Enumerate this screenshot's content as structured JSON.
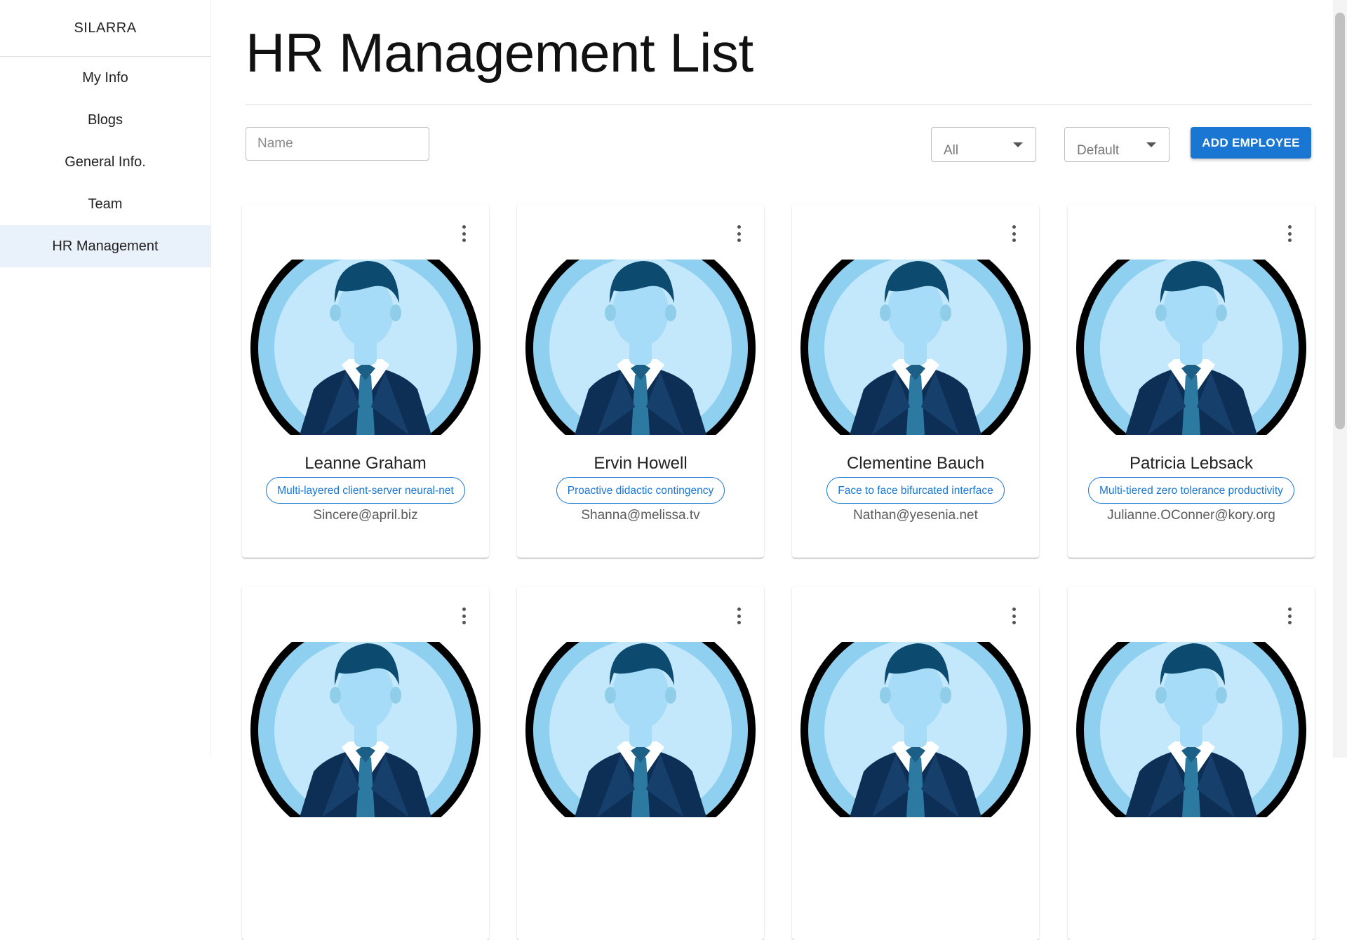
{
  "sidebar": {
    "brand": "SILARRA",
    "items": [
      {
        "label": "My Info"
      },
      {
        "label": "Blogs"
      },
      {
        "label": "General Info."
      },
      {
        "label": "Team"
      },
      {
        "label": "HR Management",
        "active": true
      }
    ]
  },
  "main": {
    "title": "HR Management List",
    "search": {
      "placeholder": "Name",
      "value": ""
    },
    "role_filter": {
      "selected": "All"
    },
    "sort_select": {
      "selected": "Default"
    },
    "add_button": "ADD EMPLOYEE"
  },
  "colors": {
    "accent": "#1976d2",
    "active_nav_bg": "#e9f1fb",
    "avatar_ring": "#000000",
    "avatar_bg": "#8fd0f0"
  },
  "employees": [
    {
      "name": "Leanne Graham",
      "tag": "Multi-layered client-server neural-net",
      "email": "Sincere@april.biz"
    },
    {
      "name": "Ervin Howell",
      "tag": "Proactive didactic contingency",
      "email": "Shanna@melissa.tv"
    },
    {
      "name": "Clementine Bauch",
      "tag": "Face to face bifurcated interface",
      "email": "Nathan@yesenia.net"
    },
    {
      "name": "Patricia Lebsack",
      "tag": "Multi-tiered zero tolerance productivity",
      "email": "Julianne.OConner@kory.org"
    },
    {
      "name": "",
      "tag": "",
      "email": ""
    },
    {
      "name": "",
      "tag": "",
      "email": ""
    },
    {
      "name": "",
      "tag": "",
      "email": ""
    },
    {
      "name": "",
      "tag": "",
      "email": ""
    }
  ],
  "icons": {
    "card_menu": "more-vert-icon",
    "caret": "arrow-drop-down-icon",
    "avatar": "person-avatar-icon"
  }
}
